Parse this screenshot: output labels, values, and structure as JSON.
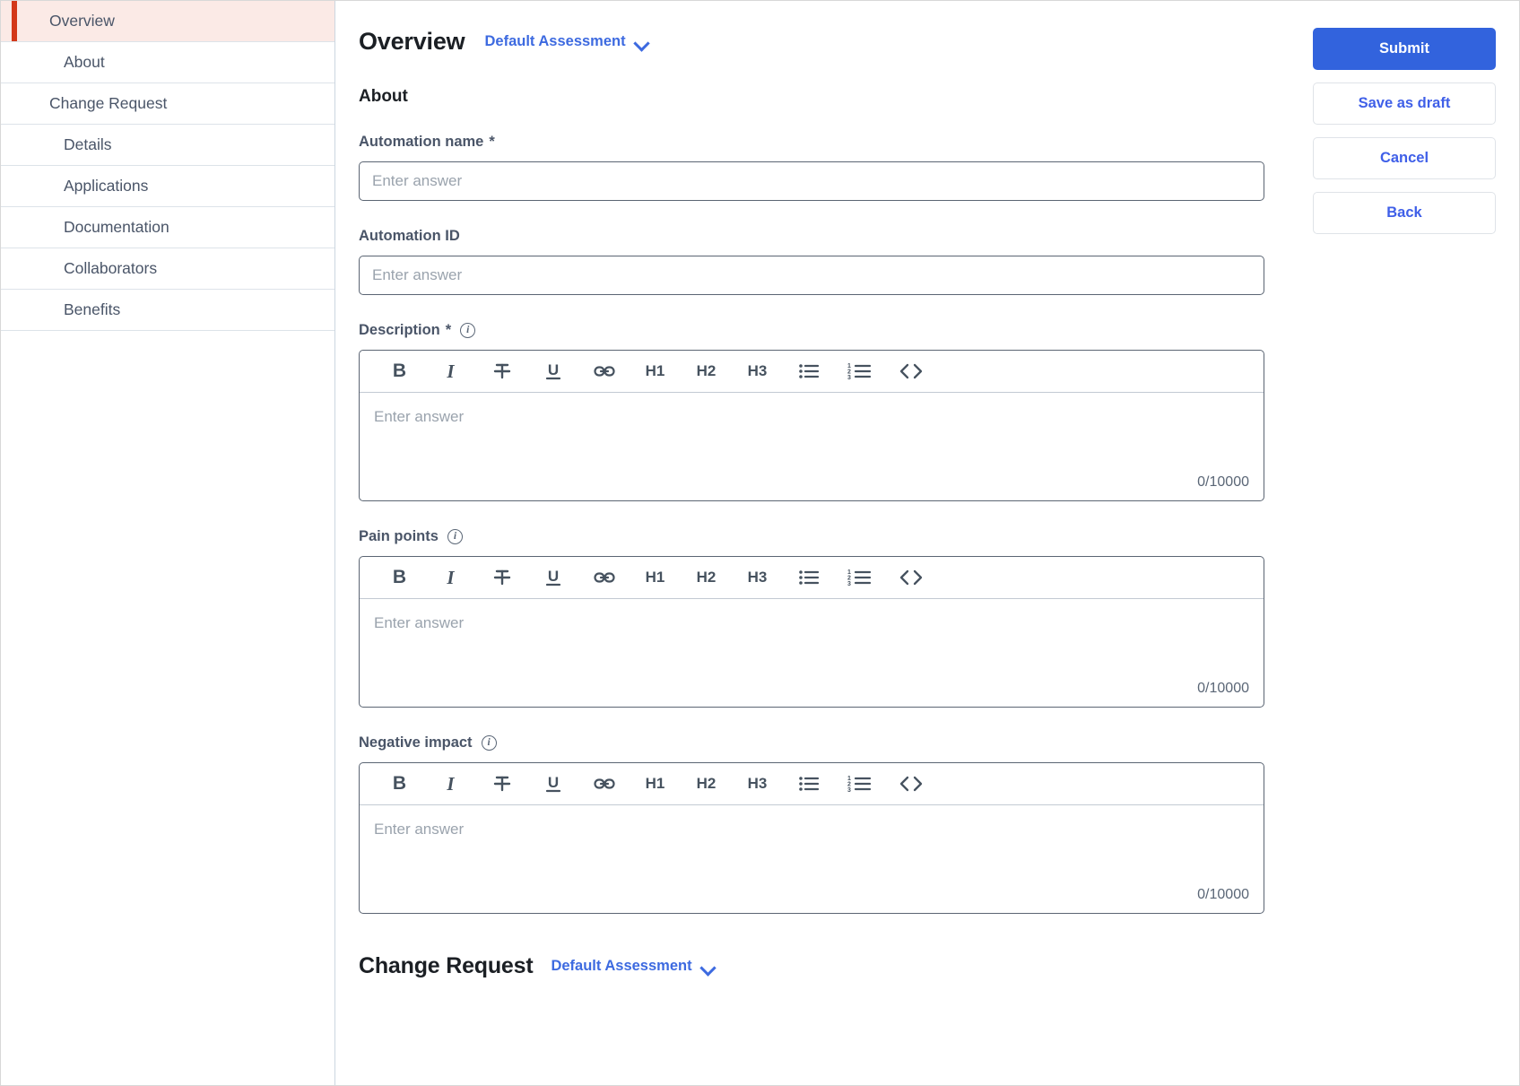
{
  "sidebar": {
    "items": [
      {
        "label": "Overview",
        "level": 0,
        "active": true
      },
      {
        "label": "About",
        "level": 1,
        "active": false
      },
      {
        "label": "Change Request",
        "level": 0,
        "active": false
      },
      {
        "label": "Details",
        "level": 1,
        "active": false
      },
      {
        "label": "Applications",
        "level": 1,
        "active": false
      },
      {
        "label": "Documentation",
        "level": 1,
        "active": false
      },
      {
        "label": "Collaborators",
        "level": 1,
        "active": false
      },
      {
        "label": "Benefits",
        "level": 1,
        "active": false
      }
    ]
  },
  "header": {
    "title": "Overview",
    "assessment_label": "Default Assessment"
  },
  "about_section": {
    "heading": "About",
    "fields": {
      "automation_name": {
        "label": "Automation name",
        "required": "*",
        "placeholder": "Enter answer",
        "value": ""
      },
      "automation_id": {
        "label": "Automation ID",
        "placeholder": "Enter answer",
        "value": ""
      },
      "description": {
        "label": "Description",
        "required": "*",
        "placeholder": "Enter answer",
        "counter": "0/10000"
      },
      "pain_points": {
        "label": "Pain points",
        "placeholder": "Enter answer",
        "counter": "0/10000"
      },
      "negative_impact": {
        "label": "Negative impact",
        "placeholder": "Enter answer",
        "counter": "0/10000"
      }
    }
  },
  "editor_toolbar": {
    "buttons": [
      {
        "name": "bold-icon",
        "text": "B"
      },
      {
        "name": "italic-icon",
        "text": "I"
      },
      {
        "name": "strikethrough-icon",
        "text": ""
      },
      {
        "name": "underline-icon",
        "text": "U"
      },
      {
        "name": "link-icon",
        "text": ""
      },
      {
        "name": "heading-1-icon",
        "text": "H1"
      },
      {
        "name": "heading-2-icon",
        "text": "H2"
      },
      {
        "name": "heading-3-icon",
        "text": "H3"
      },
      {
        "name": "bullet-list-icon",
        "text": ""
      },
      {
        "name": "numbered-list-icon",
        "text": ""
      },
      {
        "name": "code-block-icon",
        "text": ""
      }
    ]
  },
  "change_request_section": {
    "title": "Change Request",
    "assessment_label": "Default Assessment"
  },
  "actions": {
    "submit": "Submit",
    "save_draft": "Save as draft",
    "cancel": "Cancel",
    "back": "Back"
  },
  "colors": {
    "primary_blue": "#3263dd",
    "link_blue": "#3d6ae0",
    "active_accent": "#d3391a",
    "active_bg": "#fbeae6"
  }
}
